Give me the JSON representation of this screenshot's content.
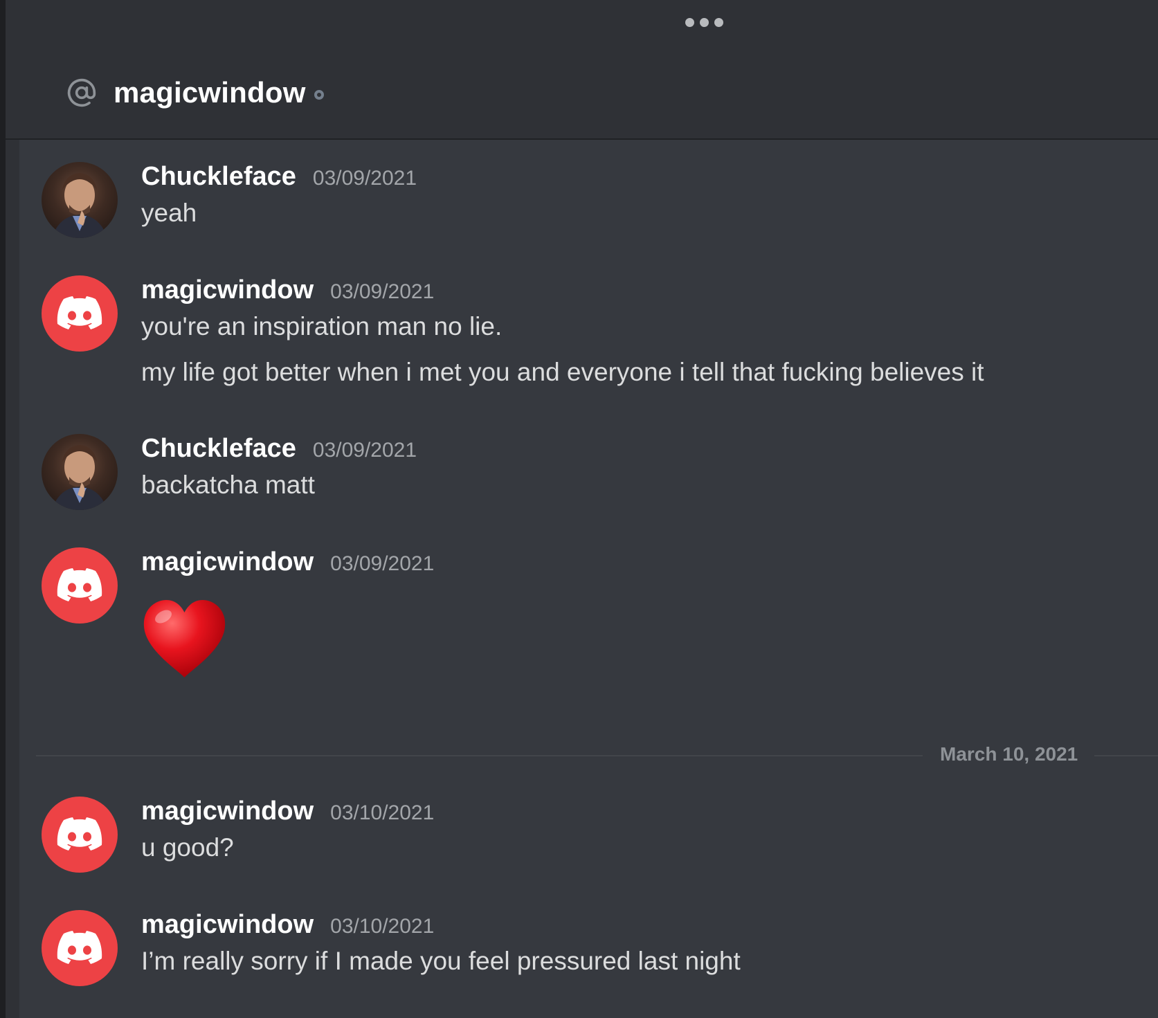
{
  "header": {
    "channel_name": "magicwindow",
    "at_icon": "at-sign-icon",
    "status": "offline-status-icon",
    "more_icon": "more-dots-icon"
  },
  "messages": [
    {
      "author": "Chuckleface",
      "timestamp": "03/09/2021",
      "avatar": "photo-avatar",
      "lines": [
        "yeah"
      ]
    },
    {
      "author": "magicwindow",
      "timestamp": "03/09/2021",
      "avatar": "discord-logo-icon",
      "lines": [
        "you're an inspiration man no lie.",
        "my life got better when i met you and everyone i tell that fucking believes it"
      ]
    },
    {
      "author": "Chuckleface",
      "timestamp": "03/09/2021",
      "avatar": "photo-avatar",
      "lines": [
        "backatcha matt"
      ]
    },
    {
      "author": "magicwindow",
      "timestamp": "03/09/2021",
      "avatar": "discord-logo-icon",
      "emoji": "heart-emoji-icon"
    },
    {
      "author": "magicwindow",
      "timestamp": "03/10/2021",
      "avatar": "discord-logo-icon",
      "lines": [
        "u good?"
      ]
    },
    {
      "author": "magicwindow",
      "timestamp": "03/10/2021",
      "avatar": "discord-logo-icon",
      "lines": [
        "I’m really sorry if I made you feel pressured last night"
      ]
    }
  ],
  "date_divider": "March 10, 2021",
  "colors": {
    "background": "#36393f",
    "header": "#2f3136",
    "discord_red": "#ed4245",
    "username": "#ffffff",
    "message_text": "#dcddde",
    "timestamp": "#a3a6aa"
  }
}
